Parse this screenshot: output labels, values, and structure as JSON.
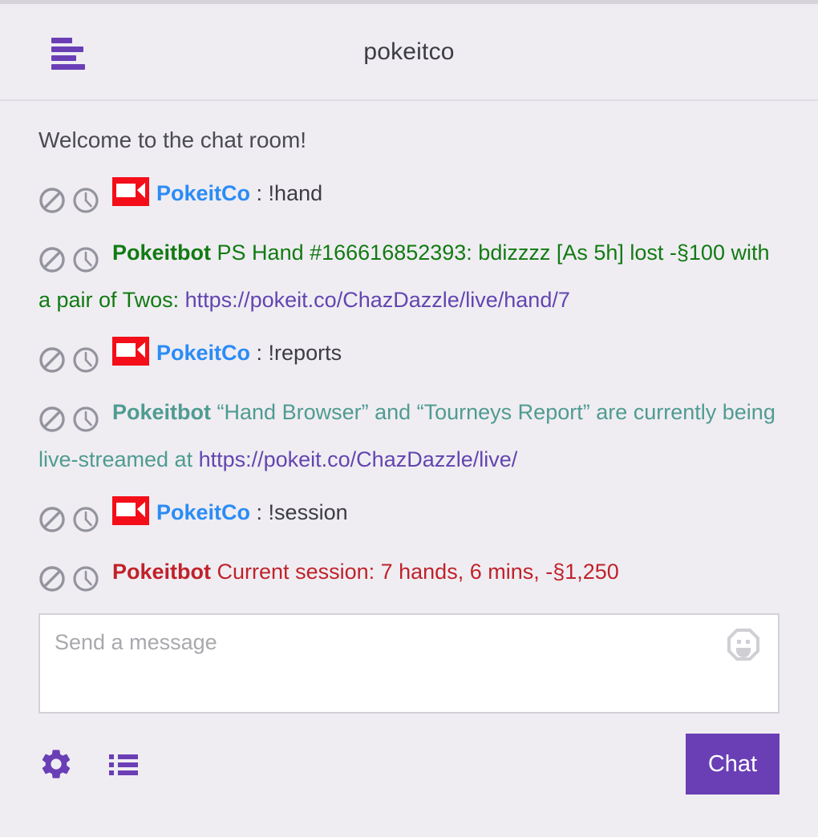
{
  "header": {
    "title": "pokeitco",
    "menu_icon": "hamburger-menu-icon"
  },
  "chat": {
    "welcome": "Welcome to the chat room!",
    "ban_icon": "ban-icon",
    "clock_icon": "clock-icon",
    "camera_icon": "video-camera-icon",
    "messages": [
      {
        "user": "PokeitCo",
        "separator": ":",
        "text": "!hand",
        "has_badge": true,
        "user_color": "#2b8cf5",
        "text_color": "#3c3c44"
      },
      {
        "user": "Pokeitbot",
        "separator": "",
        "text": "PS Hand #166616852393: bdizzzz [As 5h] lost -§100 with a pair of Twos: ",
        "link": "https://pokeit.co/ChazDazzle/live/hand/7",
        "has_badge": false,
        "user_color": "#127a12",
        "text_color": "#127a12"
      },
      {
        "user": "PokeitCo",
        "separator": ":",
        "text": "!reports",
        "has_badge": true,
        "user_color": "#2b8cf5",
        "text_color": "#3c3c44"
      },
      {
        "user": "Pokeitbot",
        "separator": "",
        "text": "“Hand Browser” and “Tourneys Report” are currently being live-streamed at ",
        "link": "https://pokeit.co/ChazDazzle/live/",
        "has_badge": false,
        "user_color": "#4f9b92",
        "text_color": "#4f9b92"
      },
      {
        "user": "PokeitCo",
        "separator": ":",
        "text": "!session",
        "has_badge": true,
        "user_color": "#2b8cf5",
        "text_color": "#3c3c44"
      },
      {
        "user": "Pokeitbot",
        "separator": "",
        "text": "Current session: 7 hands, 6 mins, -§1,250",
        "link": "",
        "has_badge": false,
        "user_color": "#c0222a",
        "text_color": "#c0222a"
      }
    ]
  },
  "composer": {
    "placeholder": "Send a message",
    "value": "",
    "emoji_icon": "emoji-smiley-icon"
  },
  "toolbar": {
    "settings_icon": "gear-icon",
    "list_icon": "list-icon",
    "send_label": "Chat"
  },
  "colors": {
    "accent_purple": "#6a3fb5",
    "link_purple": "#6345b0",
    "page_background": "#efedf2",
    "badge_red": "#f40e19",
    "user_blue": "#2b8cf5",
    "bot_green": "#127a12",
    "bot_teal": "#4f9b92",
    "bot_red": "#c0222a"
  }
}
